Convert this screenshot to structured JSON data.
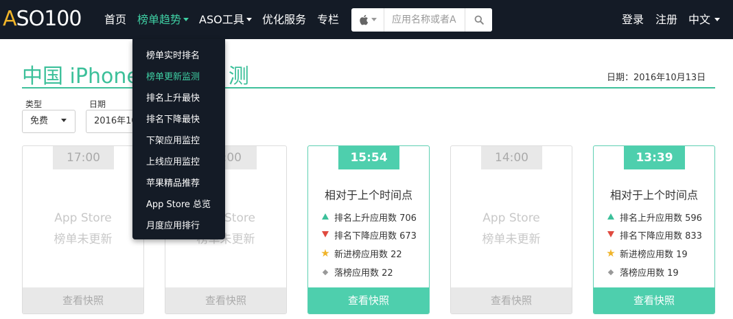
{
  "nav": {
    "logo": "ASO100",
    "items": [
      {
        "label": "首页"
      },
      {
        "label": "榜单趋势"
      },
      {
        "label": "ASO工具"
      },
      {
        "label": "优化服务"
      },
      {
        "label": "专栏"
      }
    ],
    "search_placeholder": "应用名称或者A",
    "login": "登录",
    "register": "注册",
    "language": "中文"
  },
  "dropdown": {
    "items": [
      {
        "label": "榜单实时排名"
      },
      {
        "label": "榜单更新监测"
      },
      {
        "label": "排名上升最快"
      },
      {
        "label": "排名下降最快"
      },
      {
        "label": "下架应用监控"
      },
      {
        "label": "上线应用监控"
      },
      {
        "label": "苹果精品推荐"
      },
      {
        "label": "App Store 总览"
      },
      {
        "label": "月度应用排行"
      }
    ]
  },
  "page": {
    "title": "中国 iPhone",
    "title_tail": "测",
    "date": "日期：2016年10月13日"
  },
  "filters": {
    "type_label": "类型",
    "type_value": "免费",
    "date_label": "日期",
    "date_value": "2016年10"
  },
  "cards": [
    {
      "time": "17:00",
      "na_line1": "App Store",
      "na_line2": "榜单未更新",
      "snapshot": "查看快照"
    },
    {
      "time": ":00",
      "na_line1": "Store",
      "na_line2": "榜单未更新",
      "snapshot": "查看快照"
    },
    {
      "time": "15:54",
      "relative": "相对于上个时间点",
      "up": "排名上升应用数 706",
      "down": "排名下降应用数 673",
      "new": "新进榜应用数 22",
      "dropped": "落榜应用数 22",
      "snapshot": "查看快照"
    },
    {
      "time": "14:00",
      "na_line1": "App Store",
      "na_line2": "榜单未更新",
      "snapshot": "查看快照"
    },
    {
      "time": "13:39",
      "relative": "相对于上个时间点",
      "up": "排名上升应用数 596",
      "down": "排名下降应用数 833",
      "new": "新进榜应用数 19",
      "dropped": "落榜应用数 19",
      "snapshot": "查看快照"
    }
  ],
  "colors": {
    "nav_bg": "#141b26",
    "accent": "#3cc09a",
    "card_active": "#4ecfad",
    "down_red": "#e04a3f",
    "star_yellow": "#f0b429"
  }
}
